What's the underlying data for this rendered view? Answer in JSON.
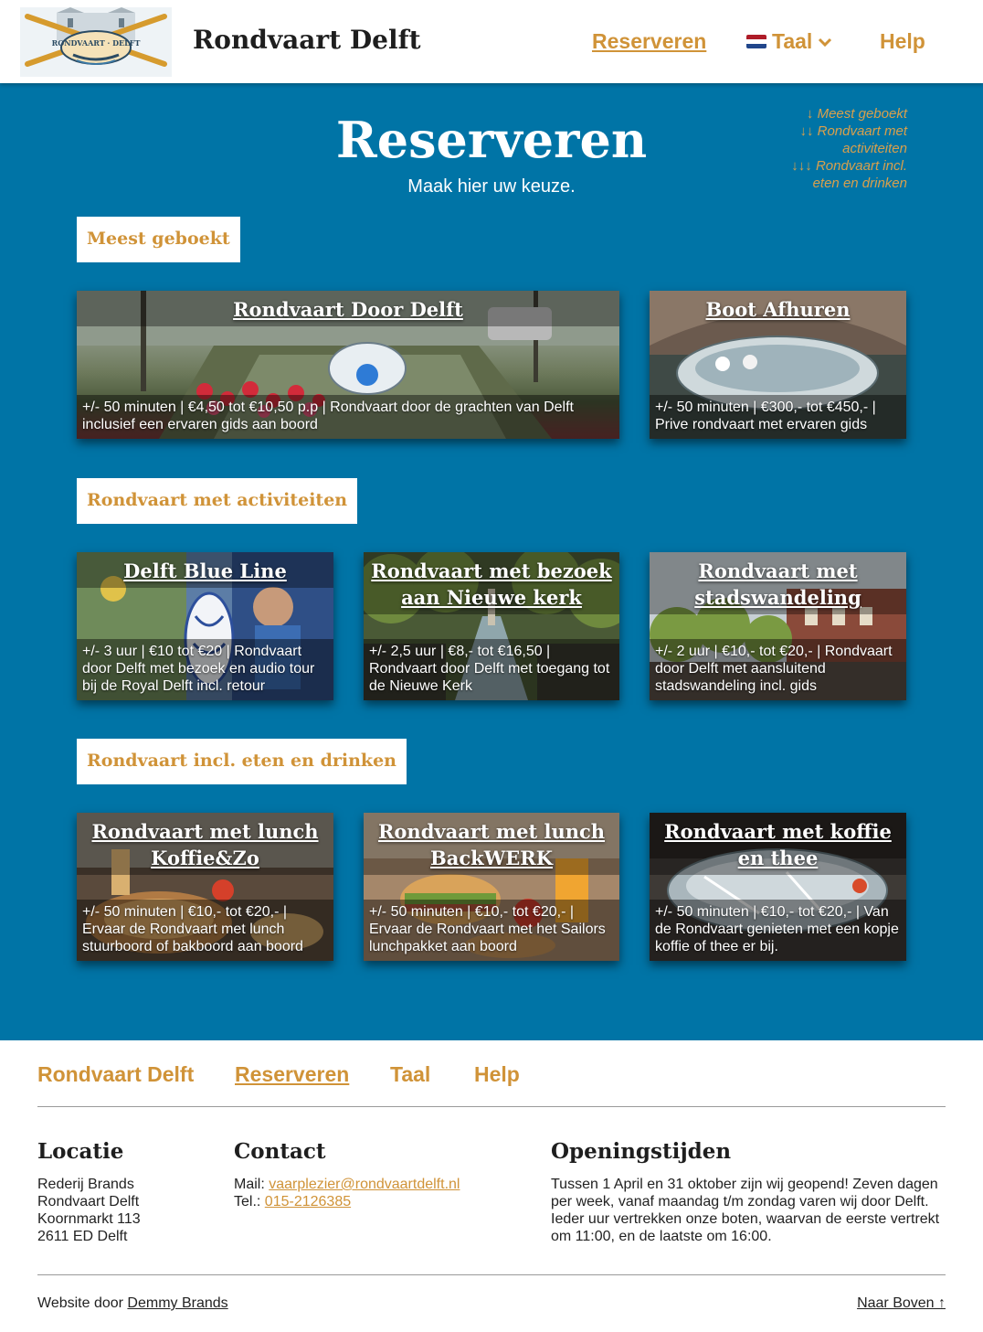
{
  "header": {
    "brand": "Rondvaart Delft",
    "nav": {
      "reserveren": "Reserveren",
      "taal": "Taal",
      "help": "Help"
    },
    "logo_text": "RONDVAART · DELFT"
  },
  "hero": {
    "title": "Reserveren",
    "subtitle": "Maak hier uw keuze.",
    "quicknav": [
      {
        "arrows": "↓",
        "label": "Meest geboekt"
      },
      {
        "arrows": "↓↓",
        "label": "Rondvaart met",
        "label2": "activiteiten"
      },
      {
        "arrows": "↓↓↓",
        "label": "Rondvaart incl.",
        "label2": "eten en drinken"
      }
    ]
  },
  "sections": [
    {
      "label": "Meest geboekt",
      "cards": [
        {
          "title": "Rondvaart Door Delft",
          "desc": "+/- 50 minuten | €4,50 tot €10,50 p.p | Rondvaart door de grachten van Delft inclusief een ervaren gids aan boord"
        },
        {
          "title": "Boot Afhuren",
          "desc": "+/- 50 minuten | €300,- tot €450,- | Prive rondvaart met ervaren gids"
        }
      ]
    },
    {
      "label": "Rondvaart met activiteiten",
      "cards": [
        {
          "title": "Delft Blue Line",
          "desc": "+/- 3 uur | €10 tot €20 | Rondvaart door Delft met bezoek en audio tour bij de Royal Delft incl. retour"
        },
        {
          "title": "Rondvaart met bezoek aan Nieuwe kerk",
          "desc": "+/- 2,5 uur | €8,- tot €16,50 | Rondvaart door Delft met toegang tot de Nieuwe Kerk"
        },
        {
          "title": "Rondvaart met stadswandeling",
          "desc": "+/- 2 uur | €10,- tot €20,- | Rondvaart door Delft met aansluitend stadswandeling incl. gids"
        }
      ]
    },
    {
      "label": "Rondvaart incl. eten en drinken",
      "cards": [
        {
          "title": "Rondvaart met lunch Koffie&Zo",
          "desc": "+/- 50 minuten | €10,- tot €20,- | Ervaar de Rondvaart met lunch stuurboord of bakboord aan boord"
        },
        {
          "title": "Rondvaart met lunch BackWERK",
          "desc": "+/- 50 minuten | €10,- tot €20,- | Ervaar de Rondvaart met het Sailors lunchpakket aan boord"
        },
        {
          "title": "Rondvaart met koffie en thee",
          "desc": "+/- 50 minuten | €10,- tot €20,- | Van de Rondvaart genieten met een kopje koffie of thee er bij."
        }
      ]
    }
  ],
  "footer": {
    "nav": {
      "brand": "Rondvaart Delft",
      "reserveren": "Reserveren",
      "taal": "Taal",
      "help": "Help"
    },
    "locatie": {
      "heading": "Locatie",
      "lines": [
        "Rederij Brands",
        "Rondvaart Delft",
        "Koornmarkt 113",
        "2611 ED Delft"
      ]
    },
    "contact": {
      "heading": "Contact",
      "mail_label": "Mail: ",
      "mail": "vaarplezier@rondvaartdelft.nl",
      "tel_label": "Tel.: ",
      "tel": "015-2126385"
    },
    "openingstijden": {
      "heading": "Openingstijden",
      "lines": [
        "Tussen 1 April en 31 oktober zijn wij geopend! Zeven dagen",
        "per week, vanaf maandag t/m zondag varen wij door Delft.",
        "Ieder uur vertrekken onze boten, waarvan de eerste vertrekt",
        "om 11:00, en de laatste om 16:00."
      ]
    },
    "credit_prefix": "Website door ",
    "credit_name": "Demmy Brands",
    "back_to_top": "Naar Boven ↑"
  }
}
